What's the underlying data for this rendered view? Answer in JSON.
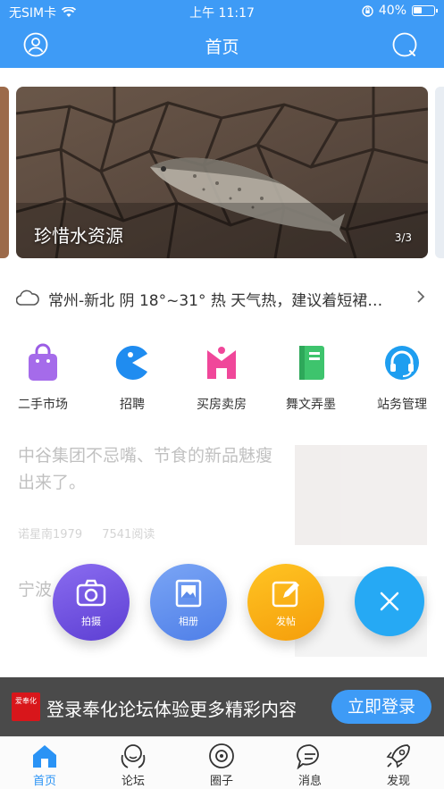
{
  "status_bar": {
    "carrier": "无SIM卡",
    "time": "上午 11:17",
    "battery": "40%"
  },
  "header": {
    "title": "首页"
  },
  "banner": {
    "caption": "珍惜水资源",
    "counter": "3/3"
  },
  "weather": {
    "text": "常州-新北 阴 18°~31° 热 天气热，建议着短裙…"
  },
  "shortcuts": [
    {
      "label": "二手市场",
      "icon": "shopping-bag-icon",
      "color": "#9b5de5"
    },
    {
      "label": "招聘",
      "icon": "pacman-icon",
      "color": "#2a8cf0"
    },
    {
      "label": "买房卖房",
      "icon": "house-icon",
      "color": "#f0479a"
    },
    {
      "label": "舞文弄墨",
      "icon": "book-icon",
      "color": "#3ec46d"
    },
    {
      "label": "站务管理",
      "icon": "headset-icon",
      "color": "#1e9ef0"
    }
  ],
  "article": {
    "title": "中谷集团不忌嘴、节食的新品魅瘦出来了。",
    "author": "诺星南1979",
    "views": "7541阅读",
    "second_title": "宁波…6…一…"
  },
  "fab": {
    "camera_label": "拍摄",
    "album_label": "相册",
    "post_label": "发帖"
  },
  "login_bar": {
    "logo_text": "爱奉化",
    "text": "登录奉化论坛体验更多精彩内容",
    "button": "立即登录"
  },
  "tabbar": [
    {
      "label": "首页",
      "icon": "home-icon",
      "active": true
    },
    {
      "label": "论坛",
      "icon": "forum-icon",
      "active": false
    },
    {
      "label": "圈子",
      "icon": "circle-icon",
      "active": false
    },
    {
      "label": "消息",
      "icon": "message-icon",
      "active": false
    },
    {
      "label": "发现",
      "icon": "rocket-icon",
      "active": false
    }
  ]
}
